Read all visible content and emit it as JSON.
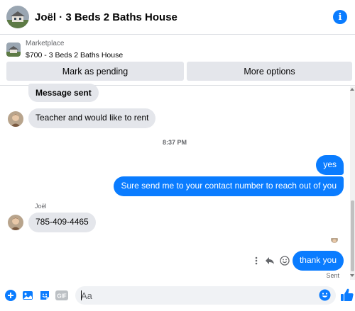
{
  "header": {
    "title": "Joël · 3 Beds 2 Baths House",
    "avatar_icon": "house-photo-avatar",
    "info_icon": "info-icon",
    "info_glyph": "i"
  },
  "marketplace": {
    "label": "Marketplace",
    "listing": "$700 - 3 Beds 2 Baths House",
    "thumb_icon": "house-thumbnail"
  },
  "actions": {
    "mark_pending": "Mark as pending",
    "more_options": "More options"
  },
  "messages": {
    "msg1": "Message sent",
    "msg2": "Teacher and would like to rent",
    "timestamp": "8:37 PM",
    "msg3": "yes",
    "msg4": "Sure send me to your contact number to reach out of you",
    "sender": "Joël",
    "msg5": "785-409-4465",
    "msg6": "thank you",
    "status": "Sent"
  },
  "composer": {
    "placeholder": "Aa",
    "icons": [
      "plus-icon",
      "image-icon",
      "sticker-icon",
      "gif-icon",
      "emoji-icon",
      "thumbs-up-icon"
    ],
    "gif_label": "GIF"
  },
  "colors": {
    "accent": "#0a7cff",
    "bubble_in": "#e4e6eb",
    "muted_text": "#65676b"
  }
}
